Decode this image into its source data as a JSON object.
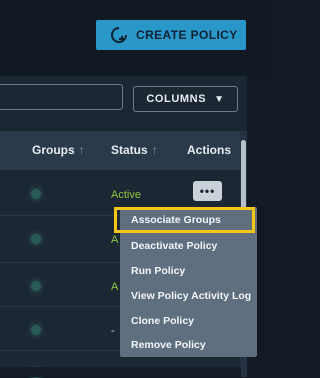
{
  "toolbar": {
    "create_label": "CREATE POLICY",
    "columns_label": "COLUMNS"
  },
  "table": {
    "headers": {
      "groups": "Groups",
      "status": "Status",
      "actions": "Actions"
    },
    "rows": [
      {
        "status": "Active"
      },
      {
        "status": "A"
      },
      {
        "status": "A"
      },
      {
        "status": "-"
      }
    ],
    "actions_button": "•••"
  },
  "context_menu": {
    "items": [
      "Associate Groups",
      "Deactivate Policy",
      "Run Policy",
      "View Policy Activity Log",
      "Clone Policy",
      "Remove Policy"
    ],
    "highlighted_index": 0
  },
  "colors": {
    "accent": "#2a97c9",
    "active_status": "#8ec63f",
    "highlight_border": "#f5c518"
  }
}
